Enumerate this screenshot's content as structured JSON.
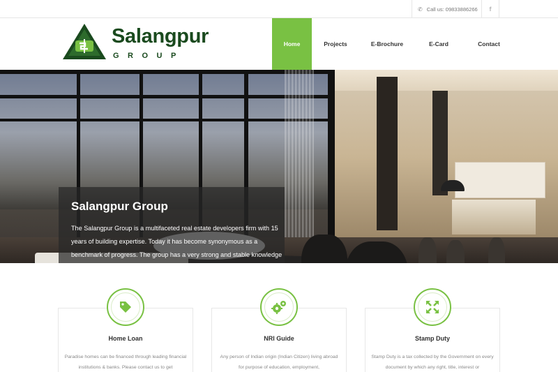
{
  "topbar": {
    "phone_text": "Call us: 09833886266",
    "phone_icon": "phone-icon",
    "social_icon": "facebook-icon",
    "social_label": "f"
  },
  "logo": {
    "brand": "Salangpur",
    "tagline": "GROUP",
    "colors": {
      "green": "#1a4a1e",
      "accent": "#79c143"
    }
  },
  "nav": {
    "items": [
      {
        "label": "Home",
        "active": true
      },
      {
        "label": "Projects",
        "active": false
      },
      {
        "label": "E-Brochure",
        "active": false
      },
      {
        "label": "E-Card",
        "active": false
      },
      {
        "label": "Contact",
        "active": false
      }
    ],
    "active_color": "#79c143"
  },
  "hero": {
    "title": "Salangpur Group",
    "description": "The Salangpur Group is a multifaceted real estate developers firm with 15 years of building expertise. Today it has become synonymous as a benchmark of progress. The group has a very strong and stable knowledge in the areas of Development and Construction. Our valued and esteemed customers get the best quality infrastructure in our project."
  },
  "features": [
    {
      "icon": "tag-icon",
      "title": "Home Loan",
      "desc": "Paradise homes can be financed through leading financial institutions & banks. Please contact us to get"
    },
    {
      "icon": "gears-icon",
      "title": "NRI Guide",
      "desc": "Any person of Indian origin (Indian Citizen) living abroad for purpose of education, employment,"
    },
    {
      "icon": "expand-arrows-icon",
      "title": "Stamp Duty",
      "desc": "Stamp Duty is a tax collected by the Government on every document by which any right, title, interest or"
    }
  ]
}
